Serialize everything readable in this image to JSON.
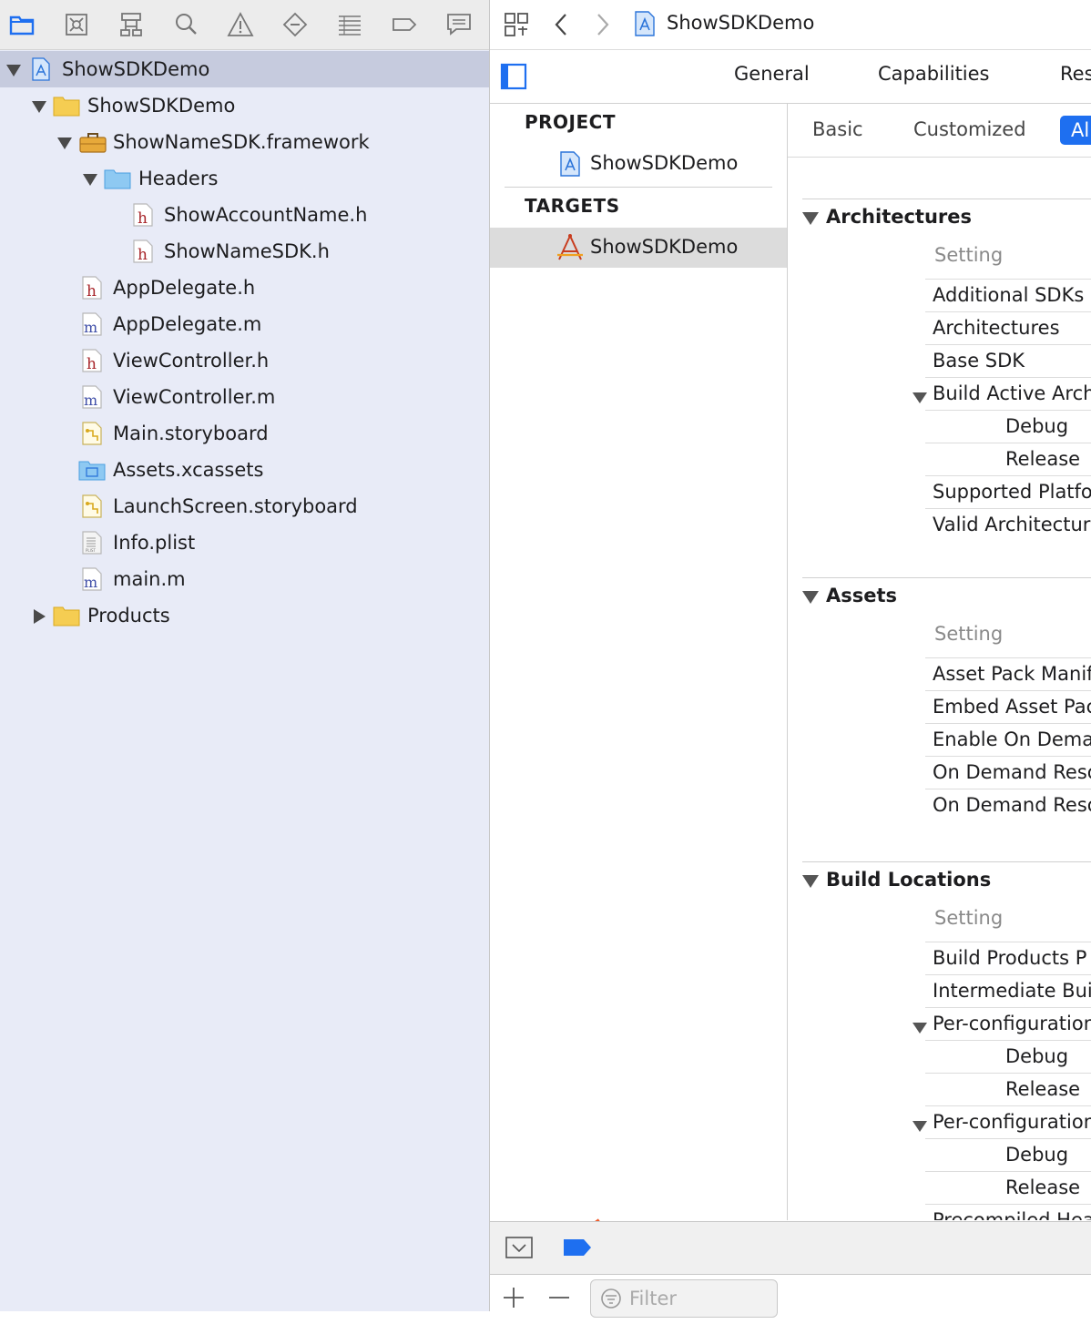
{
  "navigator": {
    "toolbar_icons": [
      "folder-icon",
      "source-control-icon",
      "hierarchy-icon",
      "search-icon",
      "warning-icon",
      "breakpoint-icon",
      "report-icon",
      "tag-icon",
      "chat-icon"
    ],
    "tree": [
      {
        "label": "ShowSDKDemo",
        "icon": "xcodeproj",
        "level": 0,
        "disclosure": "open",
        "selected": true
      },
      {
        "label": "ShowSDKDemo",
        "icon": "folder",
        "level": 1,
        "disclosure": "open"
      },
      {
        "label": "ShowNameSDK.framework",
        "icon": "framework",
        "level": 2,
        "disclosure": "open"
      },
      {
        "label": "Headers",
        "icon": "folder-blue",
        "level": 3,
        "disclosure": "open"
      },
      {
        "label": "ShowAccountName.h",
        "icon": "h",
        "level": 4
      },
      {
        "label": "ShowNameSDK.h",
        "icon": "h",
        "level": 4
      },
      {
        "label": "AppDelegate.h",
        "icon": "h",
        "level": 2
      },
      {
        "label": "AppDelegate.m",
        "icon": "m",
        "level": 2
      },
      {
        "label": "ViewController.h",
        "icon": "h",
        "level": 2
      },
      {
        "label": "ViewController.m",
        "icon": "m",
        "level": 2
      },
      {
        "label": "Main.storyboard",
        "icon": "storyboard",
        "level": 2
      },
      {
        "label": "Assets.xcassets",
        "icon": "xcassets",
        "level": 2
      },
      {
        "label": "LaunchScreen.storyboard",
        "icon": "storyboard",
        "level": 2
      },
      {
        "label": "Info.plist",
        "icon": "plist",
        "level": 2
      },
      {
        "label": "main.m",
        "icon": "m",
        "level": 2
      },
      {
        "label": "Products",
        "icon": "folder",
        "level": 1,
        "disclosure": "closed"
      }
    ]
  },
  "editor": {
    "breadcrumb_title": "ShowSDKDemo",
    "tabs": [
      "General",
      "Capabilities",
      "Res"
    ],
    "project_header": "PROJECT",
    "project_item": "ShowSDKDemo",
    "targets_header": "TARGETS",
    "target_item": "ShowSDKDemo",
    "scope_tabs": {
      "basic": "Basic",
      "customized": "Customized",
      "all": "Al"
    },
    "filter_placeholder": "Filter",
    "groups": [
      {
        "title": "Architectures",
        "column_header": "Setting",
        "rows": [
          {
            "label": "Additional SDKs"
          },
          {
            "label": "Architectures"
          },
          {
            "label": "Base SDK"
          },
          {
            "label": "Build Active Arch",
            "expand": true
          },
          {
            "label": "Debug",
            "sub": true
          },
          {
            "label": "Release",
            "sub": true
          },
          {
            "label": "Supported Platfo"
          },
          {
            "label": "Valid Architectur"
          }
        ]
      },
      {
        "title": "Assets",
        "column_header": "Setting",
        "rows": [
          {
            "label": "Asset Pack Manif"
          },
          {
            "label": "Embed Asset Pac"
          },
          {
            "label": "Enable On Dema"
          },
          {
            "label": "On Demand Reso"
          },
          {
            "label": "On Demand Reso"
          }
        ]
      },
      {
        "title": "Build Locations",
        "column_header": "Setting",
        "rows": [
          {
            "label": "Build Products P"
          },
          {
            "label": "Intermediate Buil"
          },
          {
            "label": "Per-configuration",
            "expand": true
          },
          {
            "label": "Debug",
            "sub": true
          },
          {
            "label": "Release",
            "sub": true
          },
          {
            "label": "Per-configuration",
            "expand": true
          },
          {
            "label": "Debug",
            "sub": true
          },
          {
            "label": "Release",
            "sub": true
          },
          {
            "label": "Precompiled Hea"
          }
        ]
      }
    ]
  },
  "colors": {
    "accent": "#1e6ff0",
    "arrow": "#f05a28",
    "selection_nav": "#c6cbde"
  }
}
